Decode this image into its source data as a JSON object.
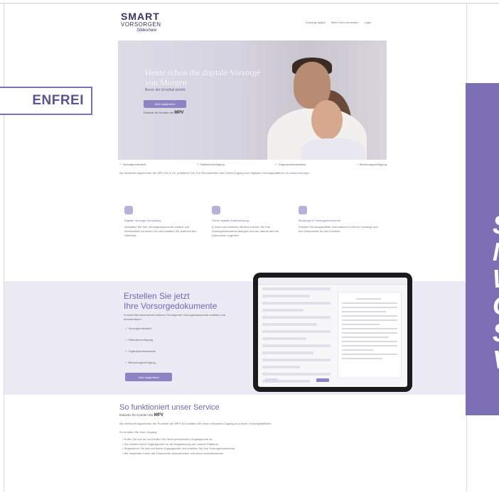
{
  "poster": {
    "left_badge": "ENFREI",
    "right_panel_letters": [
      "S",
      "N",
      "W",
      "G",
      "S",
      "V"
    ],
    "accent_color": "#7d6fb5"
  },
  "site": {
    "logo": {
      "line1": "SMART",
      "line2": "VORSORGEN",
      "line3": "Slideshare"
    },
    "nav": [
      "Vorsorge digital",
      "Mein Konto anmelden",
      "Login"
    ],
    "hero": {
      "title": "Heute schon die digitale Vorsorge von Morgen",
      "subtitle": "Bevor der Ernstfall eintritt.",
      "button": "Jetzt registrieren",
      "note": "Exklusiv für Kunden der",
      "note_brand": "MPV"
    },
    "checks": [
      "Vorsorgevollmacht",
      "Patientenverfügung",
      "Organspendeausweis",
      "Betreuungsverfügung"
    ],
    "intro": "Als Versicherungsnehmer der MPV AG & Co. profitieren Sie. Für Sie kostenfrei den Online-Zugang zum digitalen Vorsorgeplattform mit",
    "intro_link": "smartvorsorgen",
    "features": [
      {
        "icon": "calendar-icon",
        "title": "Digitale Vorsorge-Verwaltung",
        "text": "Verwalten Sie Ihre Vorsorgedokumente einfach und übersichtlich an einem Ort und behalten Sie jederzeit den Überblick."
      },
      {
        "icon": "document-icon",
        "title": "Sicher digitale Aufbewahrung",
        "text": "In Ihrem persönlichen Bereich können Sie Ihre Vorsorgedokumente ablegen und von überall auf Ihre Dokumente zugreifen."
      },
      {
        "icon": "heart-icon",
        "title": "Beratung für Vorsorgedokumente",
        "text": "Erhalten Sie ausgewählte Informationen rund um Vorsorge und Ihre Dokumente für den Ernstfall."
      }
    ],
    "band": {
      "title_line1": "Erstellen Sie jetzt",
      "title_line2": "Ihre Vorsorgedokumente",
      "text": "In ihrem Benutzerbereich können Sie folgende Vorsorgedokumente erstellen und herunterladen.",
      "items": [
        "Vorsorgevollmacht",
        "Patientenverfügung",
        "Organspendeausweis",
        "Betreuungsverfügung"
      ],
      "button": "Jetzt registrieren"
    },
    "service": {
      "title": "So funktioniert unser Service",
      "subtitle": "Exklusiv für Kunden der",
      "subtitle_brand": "MPV",
      "text1": "Als Versicherungsnehmer der Produkte der MPV AG erhalten Sie einen exklusiven Zugang zu unserer Vorsorgeplattform.",
      "text2": "So erhalten Sie Ihren Zugang:",
      "steps": [
        "Rufen Sie uns an und fordern Sie Ihren persönlichen Zugangscode an.",
        "Sie erhalten Ihren Zugangscode für die Registrierung auf unserer Plattform.",
        "Registrieren Sie sich mit Ihrem Zugangscode und erstellen Sie Ihre Vorsorgedokumente.",
        "Wir empfehlen Ihnen alle Dokumente auszudrucken und sicher aufzubewahren."
      ]
    }
  }
}
